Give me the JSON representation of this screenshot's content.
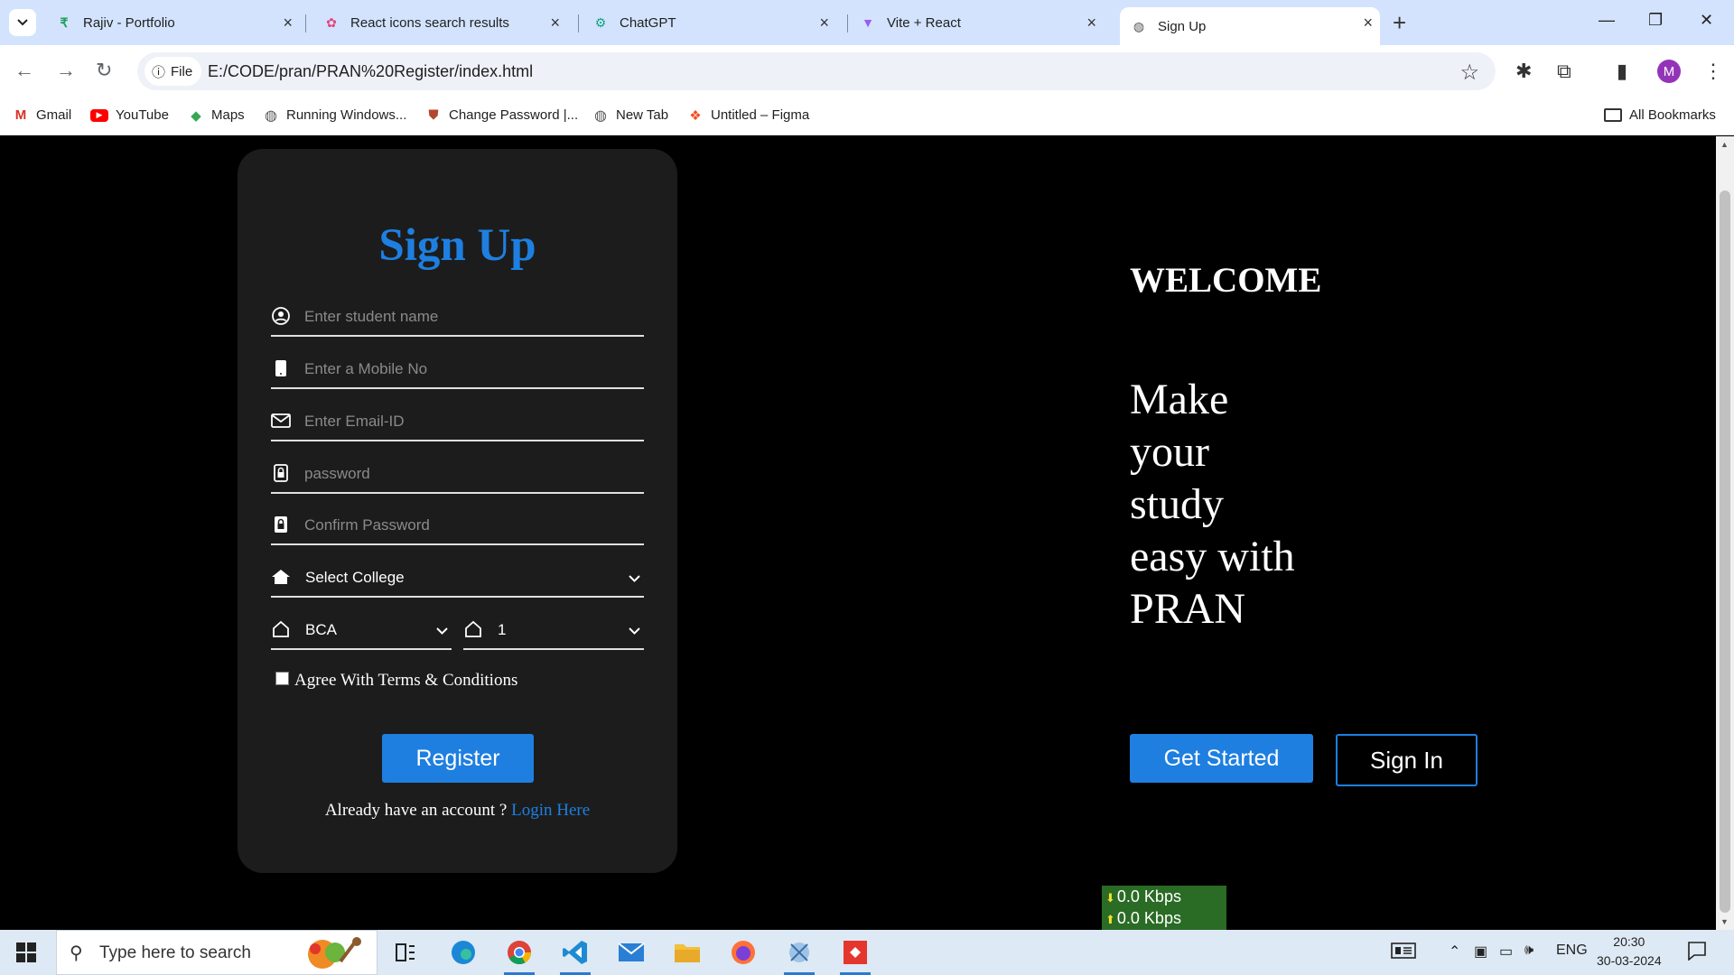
{
  "browser": {
    "tabs": [
      {
        "title": "Rajiv - Portfolio",
        "icon": "portfolio-favicon"
      },
      {
        "title": "React icons search results",
        "icon": "react-favicon"
      },
      {
        "title": "ChatGPT",
        "icon": "chatgpt-favicon"
      },
      {
        "title": "Vite + React",
        "icon": "vite-favicon"
      },
      {
        "title": "Sign Up",
        "icon": "globe-favicon",
        "active": true
      }
    ],
    "chip_label": "File",
    "url": "E:/CODE/pran/PRAN%20Register/index.html",
    "profile_initial": "M",
    "bookmarks": [
      {
        "label": "Gmail",
        "icon": "gmail-icon"
      },
      {
        "label": "YouTube",
        "icon": "youtube-icon"
      },
      {
        "label": "Maps",
        "icon": "maps-icon"
      },
      {
        "label": "Running Windows...",
        "icon": "globe-icon"
      },
      {
        "label": "Change Password |...",
        "icon": "shield-icon"
      },
      {
        "label": "New Tab",
        "icon": "globe-icon"
      },
      {
        "label": "Untitled – Figma",
        "icon": "figma-icon"
      }
    ],
    "all_bookmarks": "All Bookmarks"
  },
  "signup": {
    "title": "Sign Up",
    "fields": [
      {
        "placeholder": "Enter student name",
        "icon": "user-circle-icon"
      },
      {
        "placeholder": "Enter a Mobile No",
        "icon": "mobile-icon"
      },
      {
        "placeholder": "Enter Email-ID",
        "icon": "envelope-icon"
      },
      {
        "placeholder": "password",
        "icon": "lock-icon"
      },
      {
        "placeholder": "Confirm Password",
        "icon": "lock-icon"
      }
    ],
    "college_select": "Select College",
    "course_select": "BCA",
    "year_select": "1",
    "terms_label": "Agree With Terms & Conditions",
    "register_label": "Register",
    "already_text": "Already have an account ?",
    "login_link": "Login Here"
  },
  "hero": {
    "welcome": "WELCOME",
    "tagline": "Make your study easy with PRAN",
    "get_started": "Get Started",
    "sign_in": "Sign In"
  },
  "netmeter": {
    "down": "0.0 Kbps",
    "up": "0.0 Kbps"
  },
  "taskbar": {
    "search_placeholder": "Type here to search",
    "language": "ENG",
    "time": "20:30",
    "date": "30-03-2024"
  },
  "colors": {
    "accent": "#1e7fe0",
    "card_bg": "#1c1c1c",
    "page_bg": "#000000",
    "tabstrip": "#d3e3fd"
  }
}
